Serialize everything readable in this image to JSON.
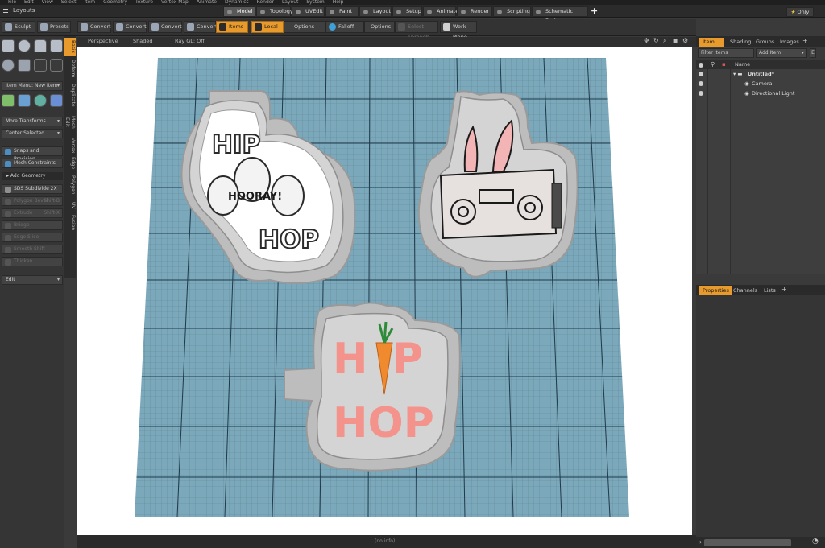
{
  "menubar": [
    "File",
    "Edit",
    "View",
    "Select",
    "Item",
    "Geometry",
    "Texture",
    "Vertex Map",
    "Animate",
    "Dynamics",
    "Render",
    "Layout",
    "System",
    "Help"
  ],
  "layoutbar": {
    "label": "Layouts",
    "tabs": [
      "Model",
      "Topology",
      "UVEdit",
      "Paint",
      "Layout",
      "Setup",
      "Animate",
      "Render",
      "Scripting",
      "Schematic Fusion"
    ],
    "active_tab": "Model",
    "add": "+",
    "only_label": "Only"
  },
  "toolbar2": {
    "sculpt": "Sculpt",
    "presets": "Presets",
    "convert1": "Convert",
    "convert2": "Convert",
    "convert3": "Convert",
    "convert4": "Convert",
    "items": "Items",
    "local": "Local",
    "options1": "Options",
    "falloff": "Falloff",
    "options2": "Options",
    "select_through": "Select Through",
    "work_plane": "Work Plane"
  },
  "leftpanel": {
    "item_menu": "Item Menu: New Item",
    "more_transforms": "More Transforms",
    "center_selected": "Center Selected",
    "snaps": "Snaps and Precision",
    "mesh_constraints": "Mesh Constraints",
    "add_geometry": "Add Geometry",
    "sds": "SDS Subdivide 2X",
    "polygon_bevel": "Polygon Bevel",
    "polygon_bevel_key": "Shift-B",
    "extrude": "Extrude",
    "extrude_key": "Shift-X",
    "bridge": "Bridge",
    "edge_slice": "Edge Slice",
    "smooth_shift": "Smooth Shift",
    "thicken": "Thicken",
    "edit": "Edit",
    "vtabs": [
      "Basic",
      "Deform",
      "Duplicate",
      "Mesh Edit",
      "Vertex",
      "Edge",
      "Polygon",
      "UV",
      "Fusion"
    ]
  },
  "viewport": {
    "perspective": "Perspective",
    "shaded": "Shaded",
    "raygl": "Ray GL: Off",
    "status": "(no info)",
    "cutter1": {
      "line1": "HIP",
      "middle": "HOORAY!",
      "line3": "HOP"
    },
    "cutter3": {
      "line1_a": "H",
      "line1_b": "P",
      "line2": "HOP"
    }
  },
  "rightpanel": {
    "tabs": [
      "Item ...",
      "Shading",
      "Groups",
      "Images"
    ],
    "filter_items": "Filter Items",
    "add_item": "Add Item",
    "col_name": "Name",
    "tree": [
      {
        "label": "Untitled*",
        "depth": 0
      },
      {
        "label": "Camera",
        "depth": 1
      },
      {
        "label": "Directional Light",
        "depth": 1
      }
    ],
    "props_tabs": [
      "Properties",
      "Channels",
      "Lists"
    ]
  },
  "colors": {
    "accent": "#e89a2c",
    "grid": "#7ba8ba",
    "cutter": "#d4d4d4",
    "pink": "#f4938c"
  }
}
